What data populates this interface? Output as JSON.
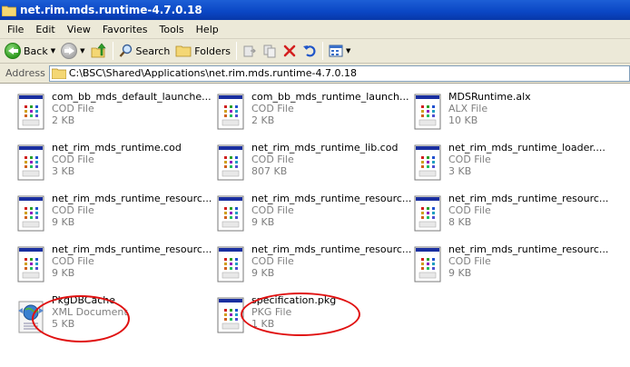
{
  "window": {
    "title": "net.rim.mds.runtime-4.7.0.18"
  },
  "menu": [
    "File",
    "Edit",
    "View",
    "Favorites",
    "Tools",
    "Help"
  ],
  "toolbar": {
    "back_label": "Back",
    "search_label": "Search",
    "folders_label": "Folders"
  },
  "address": {
    "label": "Address",
    "path": "C:\\BSC\\Shared\\Applications\\net.rim.mds.runtime-4.7.0.18"
  },
  "files": [
    {
      "name": "com_bb_mds_default_launche...",
      "type": "COD File",
      "size": "2 KB",
      "icon": "cod-file-icon"
    },
    {
      "name": "com_bb_mds_runtime_launch...",
      "type": "COD File",
      "size": "2 KB",
      "icon": "cod-file-icon"
    },
    {
      "name": "MDSRuntime.alx",
      "type": "ALX File",
      "size": "10 KB",
      "icon": "cod-file-icon"
    },
    {
      "name": "net_rim_mds_runtime.cod",
      "type": "COD File",
      "size": "3 KB",
      "icon": "cod-file-icon"
    },
    {
      "name": "net_rim_mds_runtime_lib.cod",
      "type": "COD File",
      "size": "807 KB",
      "icon": "cod-file-icon"
    },
    {
      "name": "net_rim_mds_runtime_loader....",
      "type": "COD File",
      "size": "3 KB",
      "icon": "cod-file-icon"
    },
    {
      "name": "net_rim_mds_runtime_resourc...",
      "type": "COD File",
      "size": "9 KB",
      "icon": "cod-file-icon"
    },
    {
      "name": "net_rim_mds_runtime_resourc...",
      "type": "COD File",
      "size": "9 KB",
      "icon": "cod-file-icon"
    },
    {
      "name": "net_rim_mds_runtime_resourc...",
      "type": "COD File",
      "size": "8 KB",
      "icon": "cod-file-icon"
    },
    {
      "name": "net_rim_mds_runtime_resourc...",
      "type": "COD File",
      "size": "9 KB",
      "icon": "cod-file-icon"
    },
    {
      "name": "net_rim_mds_runtime_resourc...",
      "type": "COD File",
      "size": "9 KB",
      "icon": "cod-file-icon"
    },
    {
      "name": "net_rim_mds_runtime_resourc...",
      "type": "COD File",
      "size": "9 KB",
      "icon": "cod-file-icon"
    },
    {
      "name": "PkgDBCache",
      "type": "XML Document",
      "size": "5 KB",
      "icon": "xml-document-icon"
    },
    {
      "name": "specification.pkg",
      "type": "PKG File",
      "size": "1 KB",
      "icon": "cod-file-icon"
    }
  ],
  "annotation_color": "#e01010"
}
